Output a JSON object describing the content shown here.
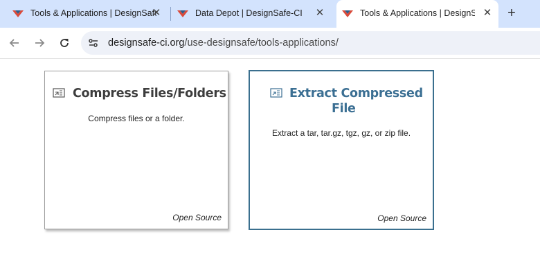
{
  "browser": {
    "tabs": [
      {
        "title": "Tools & Applications | DesignSafe-CI",
        "active": false
      },
      {
        "title": "Data Depot | DesignSafe-CI",
        "active": false
      },
      {
        "title": "Tools & Applications | DesignSafe-CI",
        "active": true
      }
    ],
    "new_tab_label": "+",
    "close_glyph": "✕",
    "url_host": "designsafe-ci.org",
    "url_path": "/use-designsafe/tools-applications/"
  },
  "cards": [
    {
      "title": "Compress Files/Folders",
      "description": "Compress files or a folder.",
      "footer": "Open Source",
      "icon": "compress-icon"
    },
    {
      "title_line1": "Extract Compressed",
      "title_line2": "File",
      "description": "Extract a tar, tar.gz, tgz, gz, or zip file.",
      "footer": "Open Source",
      "icon": "extract-icon"
    }
  ],
  "colors": {
    "tabstrip": "#d3e3fd",
    "card_title_dark": "#3d3d3d",
    "card_title_accent": "#3b6f93",
    "card_border_accent": "#3a6f8e"
  }
}
